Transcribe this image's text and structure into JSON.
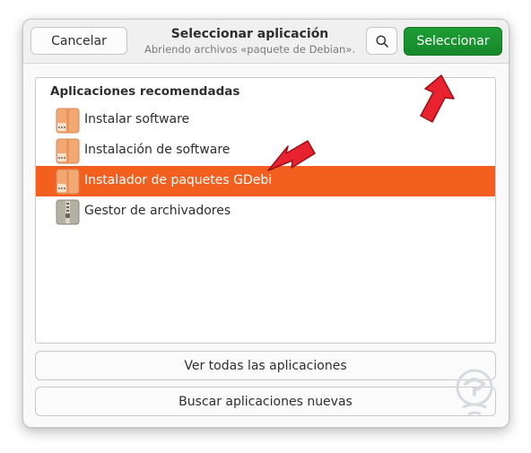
{
  "dialog": {
    "cancel_label": "Cancelar",
    "title": "Seleccionar aplicación",
    "subtitle": "Abriendo archivos «paquete de Debian».",
    "search_icon": "search-icon",
    "select_label": "Seleccionar",
    "accent_color": "#1a9530"
  },
  "list": {
    "header": "Aplicaciones recomendadas",
    "apps": [
      {
        "label": "Instalar software",
        "icon": "package-icon"
      },
      {
        "label": "Instalación de software",
        "icon": "package-icon"
      },
      {
        "label": "Instalador de paquetes GDebi",
        "icon": "package-icon",
        "selected": true
      },
      {
        "label": "Gestor de archivadores",
        "icon": "archive-icon"
      }
    ],
    "selection_color": "#f35f1e"
  },
  "footer": {
    "view_all_label": "Ver todas las aplicaciones",
    "find_new_label": "Buscar aplicaciones nuevas"
  }
}
